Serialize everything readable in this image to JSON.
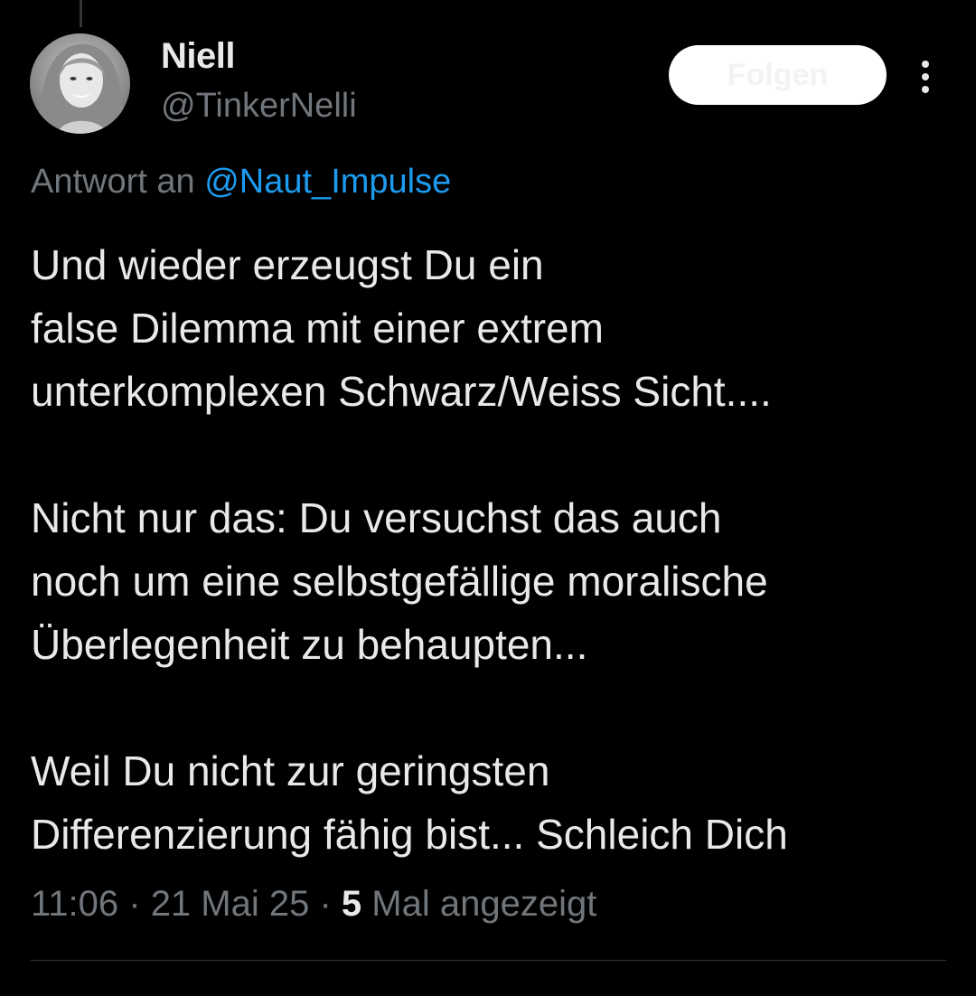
{
  "author": {
    "display_name": "Niell",
    "handle": "@TinkerNelli"
  },
  "follow_button": {
    "label": "Folgen"
  },
  "reply": {
    "prefix": "Antwort an ",
    "target": "@Naut_Impulse"
  },
  "tweet": {
    "lines": [
      "Und wieder erzeugst Du ein",
      "false Dilemma mit einer extrem",
      "unterkomplexen Schwarz/Weiss Sicht....",
      "",
      "Nicht nur das: Du versuchst das auch",
      "noch um eine selbstgefällige moralische",
      "Überlegenheit zu behaupten...",
      "",
      "Weil Du nicht zur geringsten",
      "Differenzierung fähig bist... Schleich Dich"
    ]
  },
  "meta": {
    "time": "11:06",
    "separator": " · ",
    "date": "21 Mai 25",
    "views_count": "5",
    "views_label": " Mal angezeigt"
  },
  "colors": {
    "background": "#000000",
    "text_primary": "#e7e9ea",
    "text_secondary": "#71767b",
    "link": "#1d9bf0",
    "divider": "#2f3336"
  },
  "icons": {
    "more": "more-vertical-icon"
  }
}
